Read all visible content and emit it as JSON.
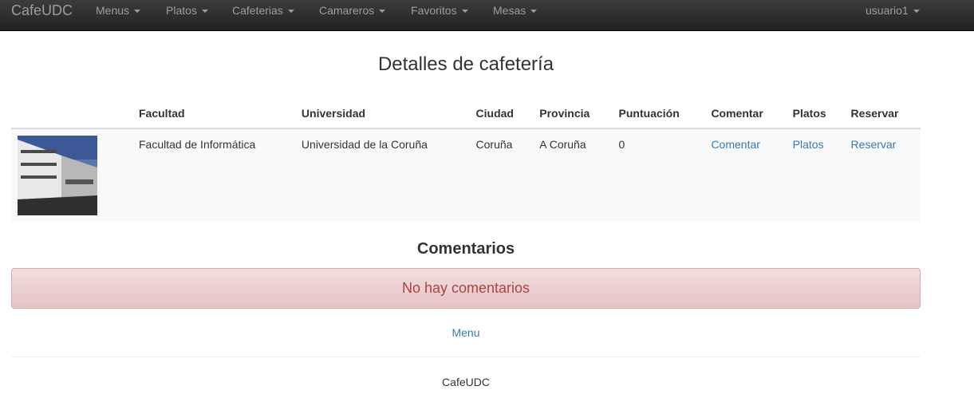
{
  "navbar": {
    "brand": "CafeUDC",
    "menus": [
      "Menus",
      "Platos",
      "Cafeterias",
      "Camareros",
      "Favoritos",
      "Mesas"
    ],
    "user": "usuario1"
  },
  "page": {
    "title": "Detalles de cafetería"
  },
  "table": {
    "headers": [
      "",
      "Facultad",
      "Universidad",
      "Ciudad",
      "Provincia",
      "Puntuación",
      "Comentar",
      "Platos",
      "Reservar"
    ],
    "row": {
      "image_alt": "building-photo",
      "facultad": "Facultad de Informática",
      "universidad": "Universidad de la Coruña",
      "ciudad": "Coruña",
      "provincia": "A Coruña",
      "puntuacion": "0",
      "comentar": "Comentar",
      "platos": "Platos",
      "reservar": "Reservar"
    }
  },
  "comments": {
    "title": "Comentarios",
    "empty_message": "No hay comentarios"
  },
  "menu_link": "Menu",
  "footer": "CafeUDC",
  "colors": {
    "navbar": "#222222",
    "nav_text": "#9d9d9d",
    "link": "#337ab7",
    "alert_bg": "#f2dede",
    "alert_text": "#a94442"
  }
}
